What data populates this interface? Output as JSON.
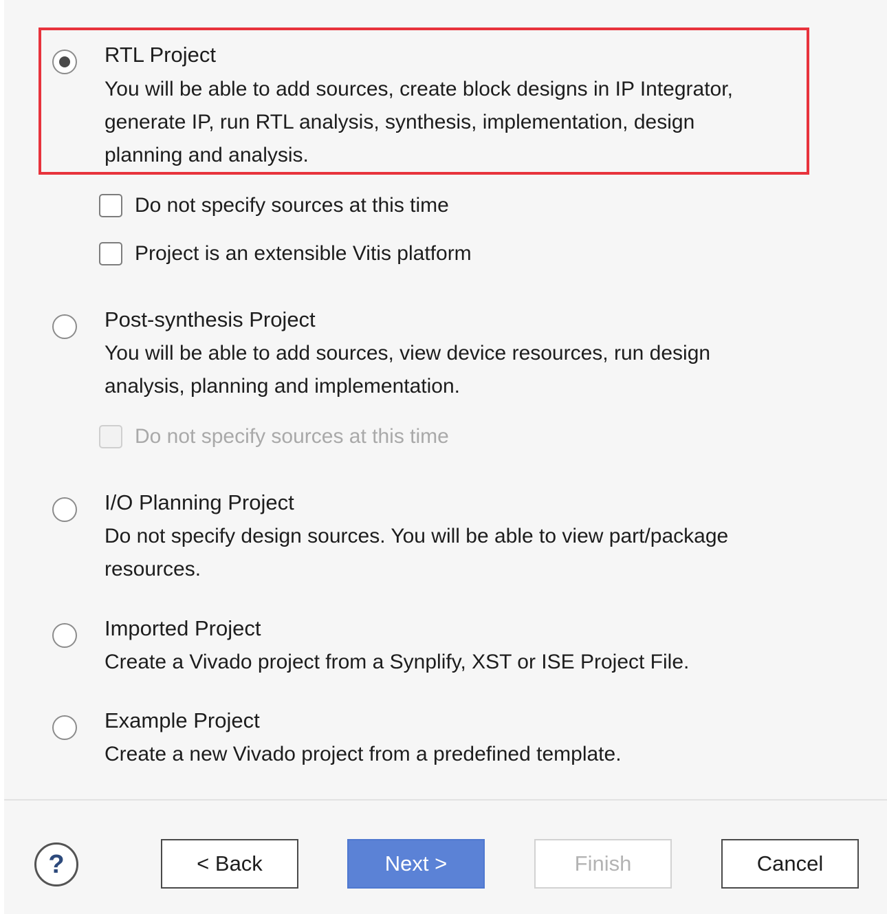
{
  "options": {
    "rtl": {
      "title": "RTL Project",
      "selected": true,
      "description_lines": [
        "You will be able to add sources, create block designs in IP Integrator,",
        "generate IP, run RTL analysis, synthesis, implementation, design",
        "planning and analysis."
      ],
      "checkboxes": [
        {
          "label": "Do not specify sources at this time",
          "checked": false,
          "enabled": true
        },
        {
          "label": "Project is an extensible Vitis platform",
          "checked": false,
          "enabled": true
        }
      ]
    },
    "post_synthesis": {
      "title": "Post-synthesis Project",
      "selected": false,
      "description_lines": [
        "You will be able to add sources, view device resources, run design",
        "analysis, planning and implementation."
      ],
      "checkboxes": [
        {
          "label": "Do not specify sources at this time",
          "checked": false,
          "enabled": false
        }
      ]
    },
    "io_planning": {
      "title": "I/O Planning Project",
      "selected": false,
      "description_lines": [
        "Do not specify design sources. You will be able to view part/package",
        "resources."
      ]
    },
    "imported": {
      "title": "Imported Project",
      "selected": false,
      "description_lines": [
        "Create a Vivado project from a Synplify, XST or ISE Project File."
      ]
    },
    "example": {
      "title": "Example Project",
      "selected": false,
      "description_lines": [
        "Create a new Vivado project from a predefined template."
      ]
    }
  },
  "footer": {
    "help_symbol": "?",
    "back_label": "< Back",
    "next_label": "Next >",
    "finish_label": "Finish",
    "cancel_label": "Cancel"
  },
  "colors": {
    "highlight_border": "#e8333c",
    "primary_button": "#5b82d6"
  }
}
